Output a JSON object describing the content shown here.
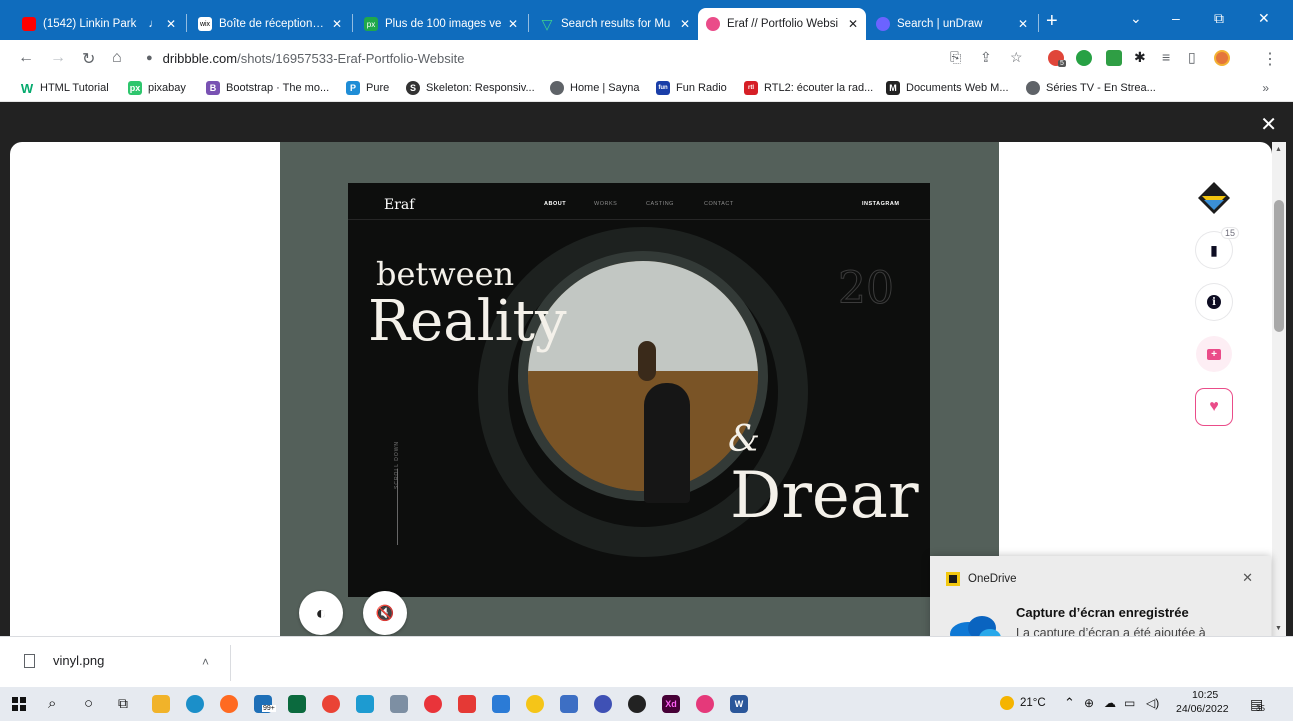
{
  "browser": {
    "tabs": [
      {
        "title": "(1542) Linkin Park",
        "audio": "♩",
        "color": "#ff0000",
        "active": false
      },
      {
        "title": "Boîte de réception | W",
        "color": "#ffffff",
        "active": false
      },
      {
        "title": "Plus de 100 images ve",
        "color": "#20a84a",
        "active": false
      },
      {
        "title": "Search results for Mu",
        "color": "#3ecf8e",
        "active": false
      },
      {
        "title": "Eraf // Portfolio Websi",
        "color": "#ea4c89",
        "active": true
      },
      {
        "title": "Search | unDraw",
        "color": "#6c63ff",
        "active": false
      }
    ],
    "new_tab": "+",
    "window_controls": {
      "chevron": "⌄",
      "minimize": "–",
      "restore": "⧉",
      "close": "✕"
    },
    "toolbar": {
      "back": "←",
      "forward": "→",
      "reload": "↻",
      "home": "⌂",
      "url_host": "dribbble.com",
      "url_path": "/shots/16957533-Eraf-Portfolio-Website",
      "lock": "🔒",
      "extension_badge": "5",
      "menu": "⋮"
    },
    "bookmarks": [
      {
        "label": "HTML Tutorial",
        "icon": "W",
        "color": "#04aa6d"
      },
      {
        "label": "pixabay",
        "icon": "px",
        "color": "#2ec66d"
      },
      {
        "label": "Bootstrap · The mo...",
        "icon": "B",
        "color": "#7952b3"
      },
      {
        "label": "Pure",
        "icon": "P",
        "color": "#1f8dd6"
      },
      {
        "label": "Skeleton: Responsiv...",
        "icon": "S",
        "color": "#333333"
      },
      {
        "label": "Home | Sayna",
        "icon": "●",
        "color": "#5f6368"
      },
      {
        "label": "Fun Radio",
        "icon": "fun",
        "color": "#1a3ea8"
      },
      {
        "label": "RTL2: écouter la rad...",
        "icon": "rtl",
        "color": "#d61f26"
      },
      {
        "label": "Documents Web M...",
        "icon": "M",
        "color": "#222222"
      },
      {
        "label": "Séries TV - En Strea...",
        "icon": "●",
        "color": "#5f6368"
      }
    ],
    "bookmarks_more": "»"
  },
  "page": {
    "close_label": "✕",
    "shot": {
      "logo": "Eraf",
      "nav": [
        "ABOUT",
        "WORKS",
        "CASTING",
        "CONTACT"
      ],
      "instagram": "INSTAGRAM",
      "headline_1": "between",
      "headline_2": "Reality",
      "headline_3": "&",
      "headline_4": "Drear",
      "outline_text": "20",
      "scroll_label": "SCROLL DOWN"
    },
    "contrast_button": "◐",
    "mute_button": "🔇",
    "sidebar": {
      "comments_count": "15",
      "comment_icon": "💬",
      "info_icon": "ⓘ",
      "collection_icon": "+",
      "like_icon": "♥"
    }
  },
  "toast": {
    "app": "OneDrive",
    "title": "Capture d’écran enregistrée",
    "body": "La capture d’écran a été ajoutée à OneDrive.",
    "close": "✕"
  },
  "downloads": {
    "file_name": "vinyl.png",
    "chevron": "˄"
  },
  "taskbar": {
    "weather": "21°C",
    "time": "10:25",
    "date": "24/06/2022",
    "notifications": "35",
    "mail_badge": "99+"
  }
}
